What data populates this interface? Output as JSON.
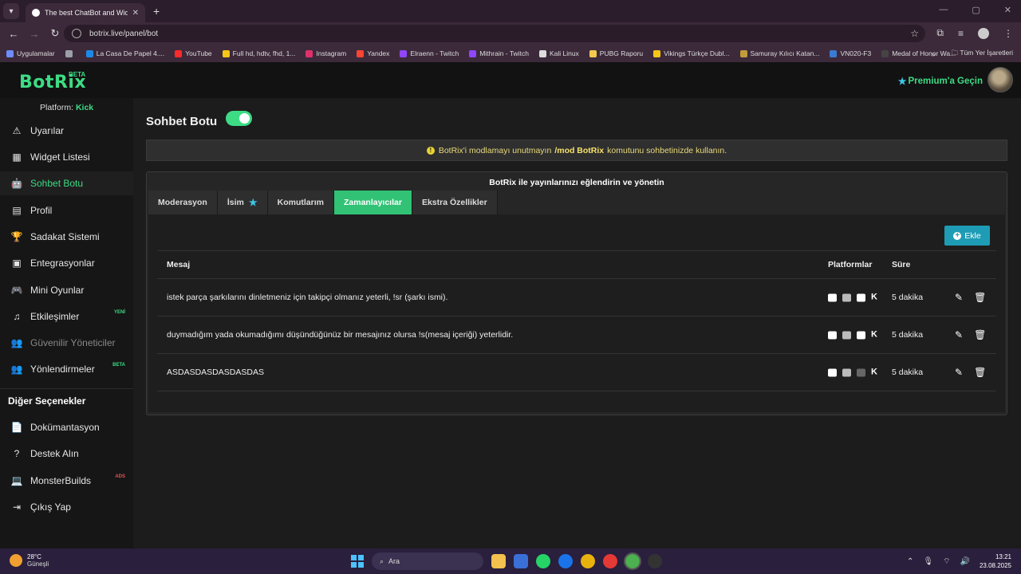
{
  "browser": {
    "tab_title": "The best ChatBot and Widgets f",
    "url": "botrix.live/panel/bot",
    "bookmarks": [
      {
        "label": "Uygulamalar",
        "color": "#6e8cff"
      },
      {
        "label": "",
        "color": "#9aa0a6"
      },
      {
        "label": "La Casa De Papel 4....",
        "color": "#1e88e5"
      },
      {
        "label": "YouTube",
        "color": "#ff2a2a"
      },
      {
        "label": "Full hd, hdtv, fhd, 1...",
        "color": "#f5c518"
      },
      {
        "label": "Instagram",
        "color": "#e1306c"
      },
      {
        "label": "Yandex",
        "color": "#ff4433"
      },
      {
        "label": "Elraenn - Twitch",
        "color": "#9146ff"
      },
      {
        "label": "Mithrain - Twitch",
        "color": "#9146ff"
      },
      {
        "label": "Kali Linux",
        "color": "#dddddd"
      },
      {
        "label": "PUBG Raporu",
        "color": "#f2c94c"
      },
      {
        "label": "Vikings Türkçe Dubl...",
        "color": "#f5c518"
      },
      {
        "label": "Samuray Kılıcı Katan...",
        "color": "#c49b3a"
      },
      {
        "label": "VN020-F3",
        "color": "#3a7bd5"
      },
      {
        "label": "Medal of Honor Wa...",
        "color": "#444444"
      }
    ],
    "all_bookmarks": "Tüm Yer İşaretleri"
  },
  "app": {
    "logo": "BotRix",
    "logo_badge": "BETA",
    "premium_label": "Premium'a Geçin",
    "platform_label": "Platform:",
    "platform_value": "Kick",
    "sidebar": [
      {
        "label": "Uyarılar",
        "icon": "⚠",
        "name": "warning-icon"
      },
      {
        "label": "Widget Listesi",
        "icon": "▦",
        "name": "grid-icon"
      },
      {
        "label": "Sohbet Botu",
        "icon": "🤖",
        "name": "robot-icon"
      },
      {
        "label": "Profil",
        "icon": "▤",
        "name": "id-card-icon"
      },
      {
        "label": "Sadakat Sistemi",
        "icon": "🏆",
        "name": "trophy-icon"
      },
      {
        "label": "Entegrasyonlar",
        "icon": "▣",
        "name": "integration-icon"
      },
      {
        "label": "Mini Oyunlar",
        "icon": "🎮",
        "name": "gamepad-icon"
      },
      {
        "label": "Etkileşimler",
        "icon": "♫",
        "name": "music-icon",
        "badge": "YENİ"
      },
      {
        "label": "Güvenilir Yöneticiler",
        "icon": "👥",
        "name": "users-icon"
      },
      {
        "label": "Yönlendirmeler",
        "icon": "👥",
        "name": "referral-icon",
        "badge": "BETA"
      }
    ],
    "section_title": "Diğer Seçenekler",
    "sidebar_other": [
      {
        "label": "Dokümantasyon",
        "icon": "📄",
        "name": "docs-icon"
      },
      {
        "label": "Destek Alın",
        "icon": "?",
        "name": "help-icon"
      },
      {
        "label": "MonsterBuilds",
        "icon": "💻",
        "name": "laptop-icon",
        "badge": "ADS"
      },
      {
        "label": "Çıkış Yap",
        "icon": "⇥",
        "name": "logout-icon"
      }
    ],
    "page_title": "Sohbet Botu",
    "notice_pre": "BotRix'i modlamayı unutmayın",
    "notice_cmd": "/mod BotRix",
    "notice_post": "komutunu sohbetinizde kullanın.",
    "panel_title": "BotRix ile yayınlarınızı eğlendirin ve yönetin",
    "tabs": [
      "Moderasyon",
      "İsim",
      "Komutlarım",
      "Zamanlayıcılar",
      "Ekstra Özellikler"
    ],
    "add_label": "Ekle",
    "table_headers": {
      "message": "Mesaj",
      "platforms": "Platformlar",
      "duration": "Süre"
    },
    "rows": [
      {
        "message": "istek parça şarkılarını dinletmeniz için takipçi olmanız yeterli, !sr (şarkı ismi).",
        "duration": "5 dakika",
        "youtube": true
      },
      {
        "message": "duymadığım yada okumadığımı düşündüğünüz bir mesajınız olursa !s(mesaj içeriği) yeterlidir.",
        "duration": "5 dakika",
        "youtube": true
      },
      {
        "message": "ASDASDASDASDASDAS",
        "duration": "5 dakika",
        "youtube": false
      }
    ]
  },
  "taskbar": {
    "temp": "28°C",
    "weather": "Güneşli",
    "search": "Ara",
    "time": "13:21",
    "date": "23.08.2025"
  },
  "colors": {
    "accent": "#3ddc84",
    "add_button": "#1e9cb5",
    "notice_text": "#e8d97a"
  }
}
